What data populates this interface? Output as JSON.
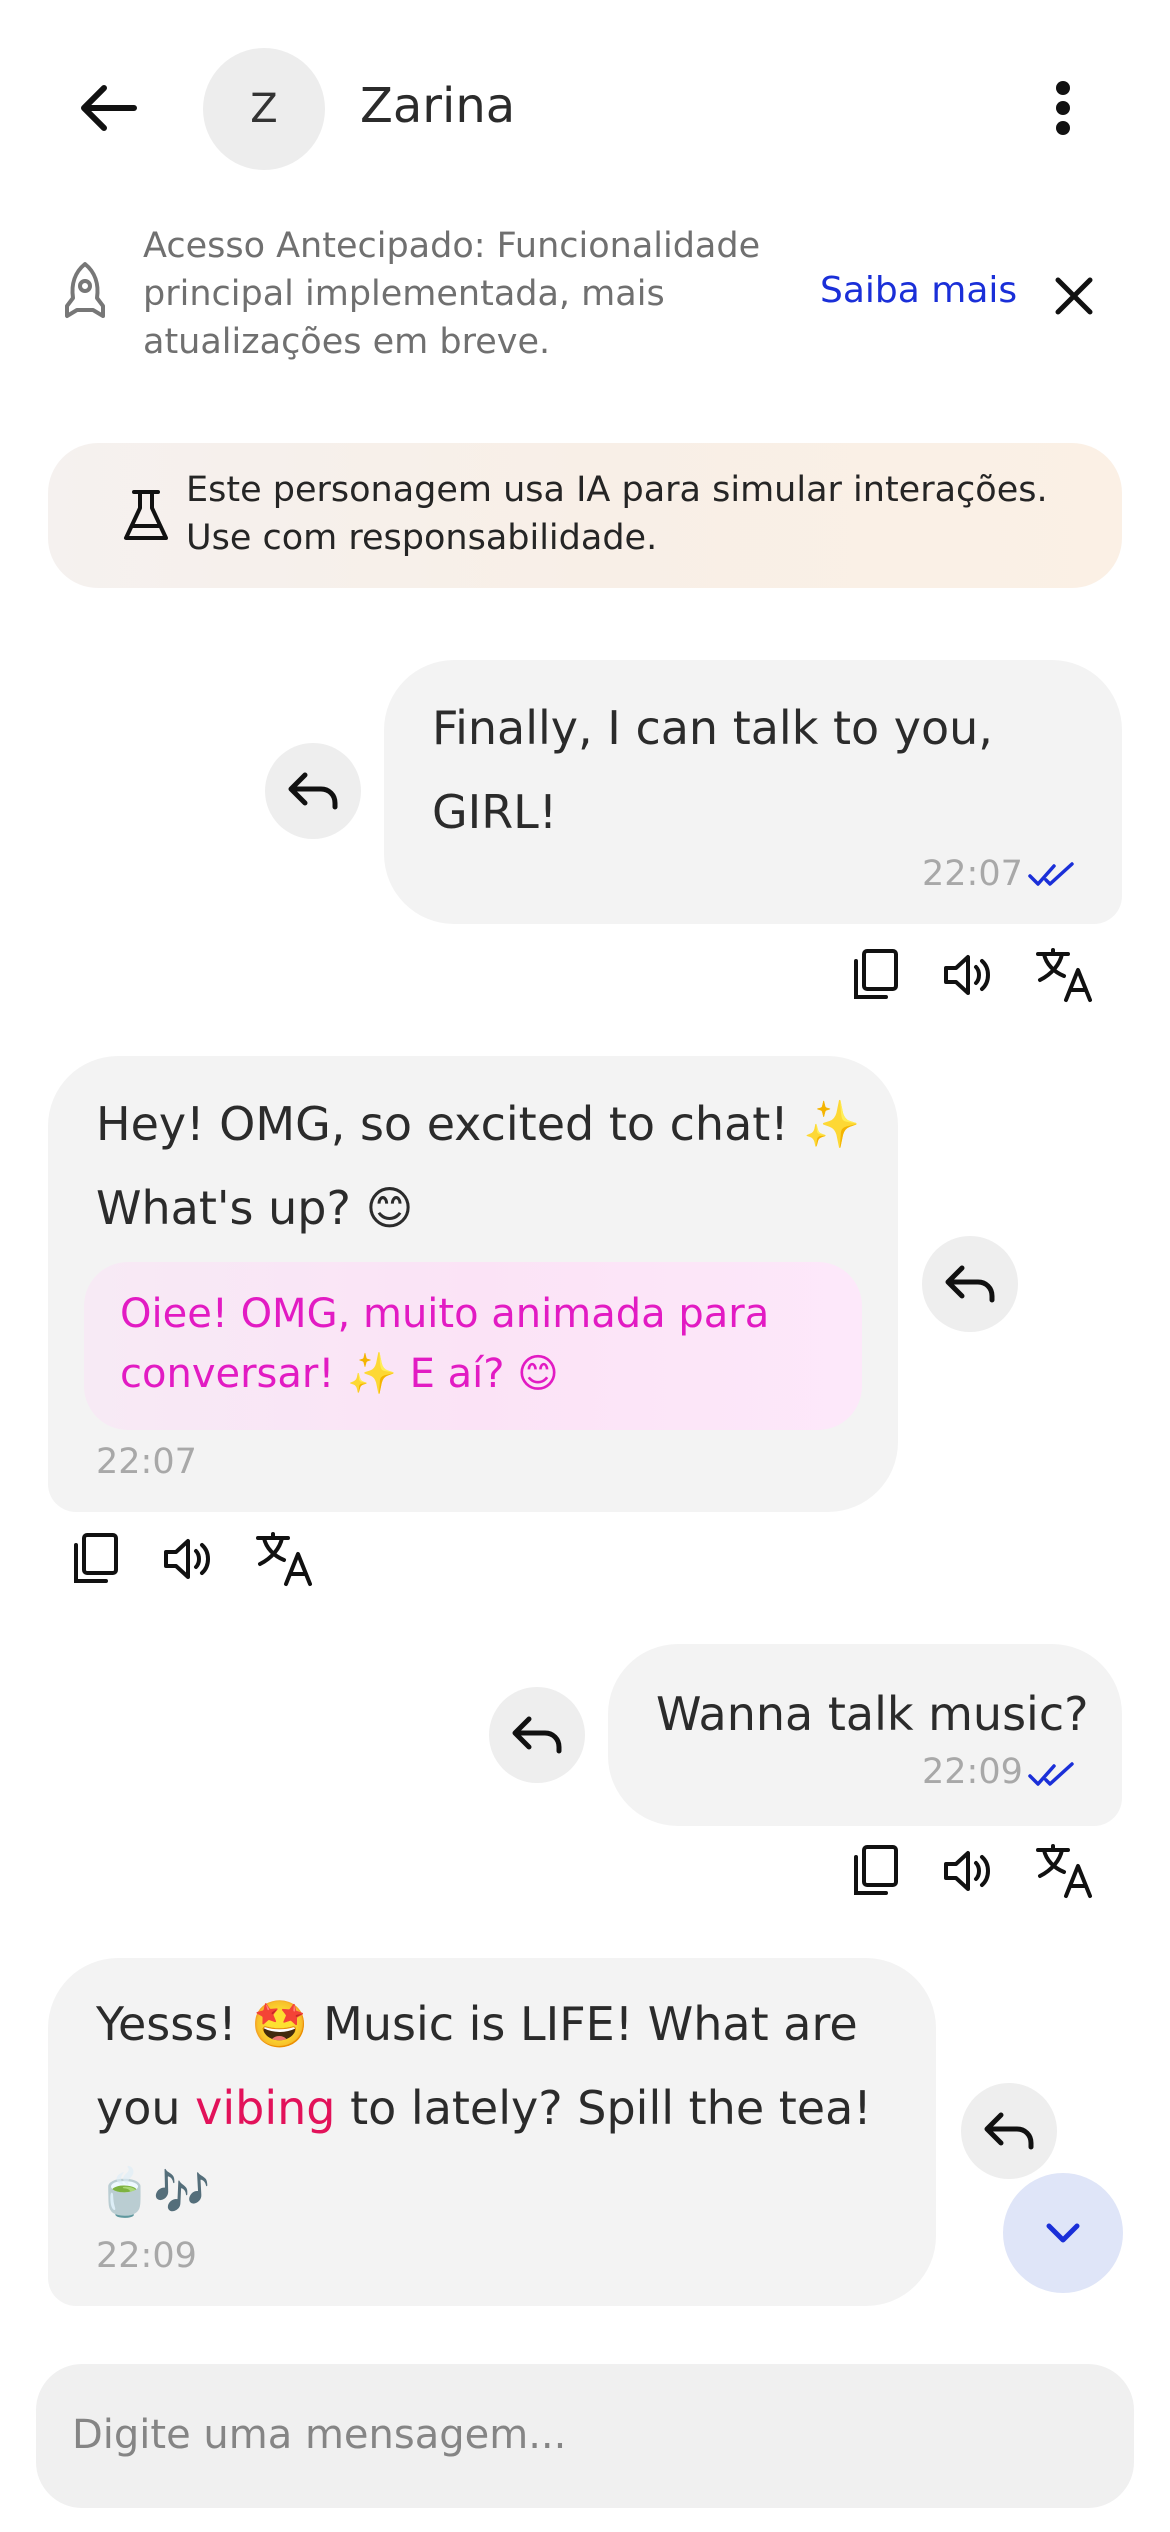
{
  "header": {
    "title": "Zarina",
    "avatar_initial": "Z"
  },
  "banner": {
    "text": "Acesso Antecipado: Funcionalidade principal implementada, mais atualizações em breve.",
    "link_label": "Saiba mais"
  },
  "disclaimer": {
    "text": "Este personagem usa IA para simular interações. Use com responsabilidade."
  },
  "messages": [
    {
      "sender": "user",
      "text": "Finally, I can talk to you, GIRL!",
      "time": "22:07",
      "status": "read"
    },
    {
      "sender": "character",
      "text": "Hey! OMG, so excited to chat! ✨ What's up? 😊",
      "translation": "Oiee! OMG, muito animada para conversar! ✨ E aí? 😊",
      "time": "22:07"
    },
    {
      "sender": "user",
      "text": "Wanna talk music?",
      "time": "22:09",
      "status": "read"
    },
    {
      "sender": "character",
      "text_before": "Yesss! 🤩 Music is LIFE! What are you ",
      "text_highlight": "vibing",
      "text_after": " to lately? Spill the tea! 🍵🎶",
      "time": "22:09"
    }
  ],
  "composer": {
    "placeholder": "Digite uma mensagem..."
  },
  "colors": {
    "accent": "#1a2fd8",
    "translation_text": "#e21bc3",
    "highlight_word": "#e2125a",
    "bubble": "#f3f3f3"
  }
}
